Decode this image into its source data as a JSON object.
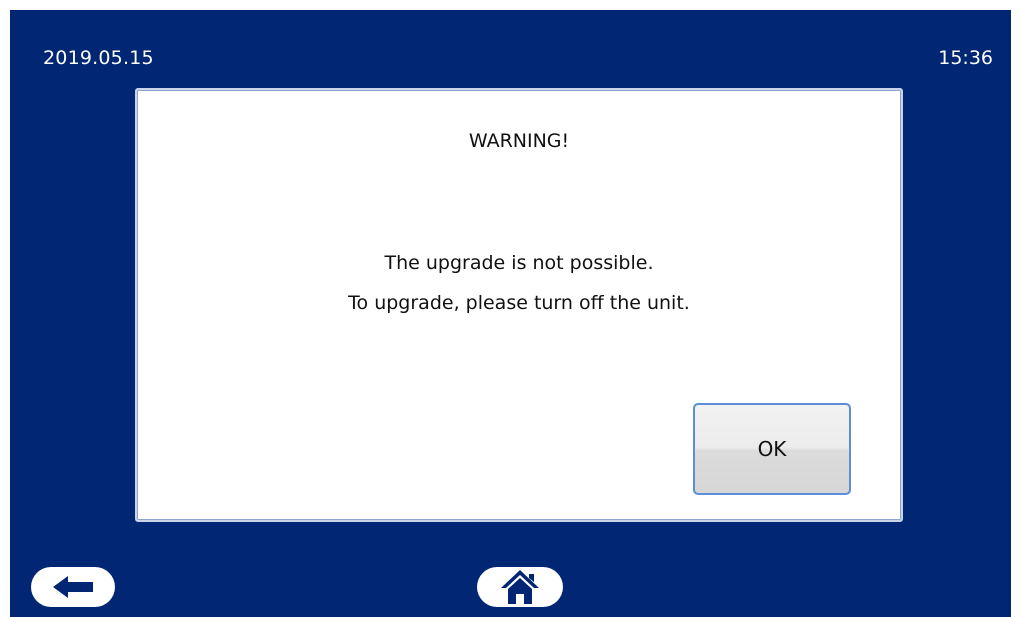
{
  "status_bar": {
    "date": "2019.05.15",
    "time": "15:36"
  },
  "dialog": {
    "title": "WARNING!",
    "message_lines": [
      "The upgrade is not possible.",
      "To upgrade, please turn off the unit."
    ],
    "ok_label": "OK"
  },
  "nav": {
    "back_icon": "back-arrow-icon",
    "home_icon": "home-icon"
  },
  "colors": {
    "background": "#012774",
    "dialog_bg": "#ffffff",
    "button_border": "#5b8ed6"
  }
}
